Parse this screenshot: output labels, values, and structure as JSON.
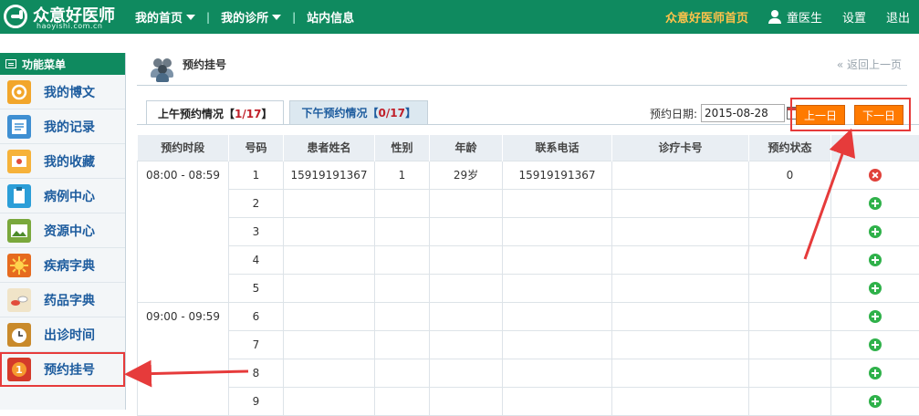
{
  "header": {
    "logo_title": "众意好医师",
    "logo_sub": "haoyishi.com.cn",
    "nav": [
      {
        "label": "我的首页",
        "has_dropdown": true
      },
      {
        "label": "我的诊所",
        "has_dropdown": true
      },
      {
        "label": "站内信息",
        "has_dropdown": false
      }
    ],
    "home_link": "众意好医师首页",
    "user_name": "童医生",
    "settings": "设置",
    "logout": "退出"
  },
  "sidebar": {
    "title": "功能菜单",
    "items": [
      {
        "label": "我的博文",
        "icon": "blog-icon"
      },
      {
        "label": "我的记录",
        "icon": "notes-icon"
      },
      {
        "label": "我的收藏",
        "icon": "favorites-icon"
      },
      {
        "label": "病例中心",
        "icon": "clipboard-icon"
      },
      {
        "label": "资源中心",
        "icon": "picture-icon"
      },
      {
        "label": "疾病字典",
        "icon": "virus-icon"
      },
      {
        "label": "药品字典",
        "icon": "pills-icon"
      },
      {
        "label": "出诊时间",
        "icon": "alarm-clock-icon"
      },
      {
        "label": "预约挂号",
        "icon": "appointment-icon",
        "active": true
      }
    ]
  },
  "page": {
    "title": "预约挂号",
    "back_link": "« 返回上一页"
  },
  "tabs": [
    {
      "label": "上午预约情况",
      "count": "1/17",
      "active": true
    },
    {
      "label": "下午预约情况",
      "count": "0/17",
      "active": false
    }
  ],
  "date": {
    "label": "预约日期:",
    "value": "2015-08-28"
  },
  "buttons": {
    "prev_day": "上一日",
    "next_day": "下一日"
  },
  "table": {
    "columns": [
      "预约时段",
      "号码",
      "患者姓名",
      "性别",
      "年龄",
      "联系电话",
      "诊疗卡号",
      "预约状态",
      ""
    ],
    "time_slots": [
      "08:00 - 08:59",
      "09:00 - 09:59"
    ],
    "rows": [
      {
        "slot": "08:00 - 08:59",
        "number": "1",
        "patient": "15919191367",
        "gender": "1",
        "age": "29岁",
        "phone": "15919191367",
        "card": "",
        "status": "0",
        "action": "delete"
      },
      {
        "slot": "08:00 - 08:59",
        "number": "2",
        "patient": "",
        "gender": "",
        "age": "",
        "phone": "",
        "card": "",
        "status": "",
        "action": "add"
      },
      {
        "slot": "08:00 - 08:59",
        "number": "3",
        "patient": "",
        "gender": "",
        "age": "",
        "phone": "",
        "card": "",
        "status": "",
        "action": "add"
      },
      {
        "slot": "08:00 - 08:59",
        "number": "4",
        "patient": "",
        "gender": "",
        "age": "",
        "phone": "",
        "card": "",
        "status": "",
        "action": "add"
      },
      {
        "slot": "08:00 - 08:59",
        "number": "5",
        "patient": "",
        "gender": "",
        "age": "",
        "phone": "",
        "card": "",
        "status": "",
        "action": "add"
      },
      {
        "slot": "09:00 - 09:59",
        "number": "6",
        "patient": "",
        "gender": "",
        "age": "",
        "phone": "",
        "card": "",
        "status": "",
        "action": "add"
      },
      {
        "slot": "09:00 - 09:59",
        "number": "7",
        "patient": "",
        "gender": "",
        "age": "",
        "phone": "",
        "card": "",
        "status": "",
        "action": "add"
      },
      {
        "slot": "09:00 - 09:59",
        "number": "8",
        "patient": "",
        "gender": "",
        "age": "",
        "phone": "",
        "card": "",
        "status": "",
        "action": "add"
      },
      {
        "slot": "09:00 - 09:59",
        "number": "9",
        "patient": "",
        "gender": "",
        "age": "",
        "phone": "",
        "card": "",
        "status": "",
        "action": "add"
      }
    ]
  },
  "colors": {
    "brand_green": "#0f8a5f",
    "accent_orange": "#ff7a00",
    "highlight_red": "#e63b3b",
    "link_blue": "#1d5c9e"
  }
}
